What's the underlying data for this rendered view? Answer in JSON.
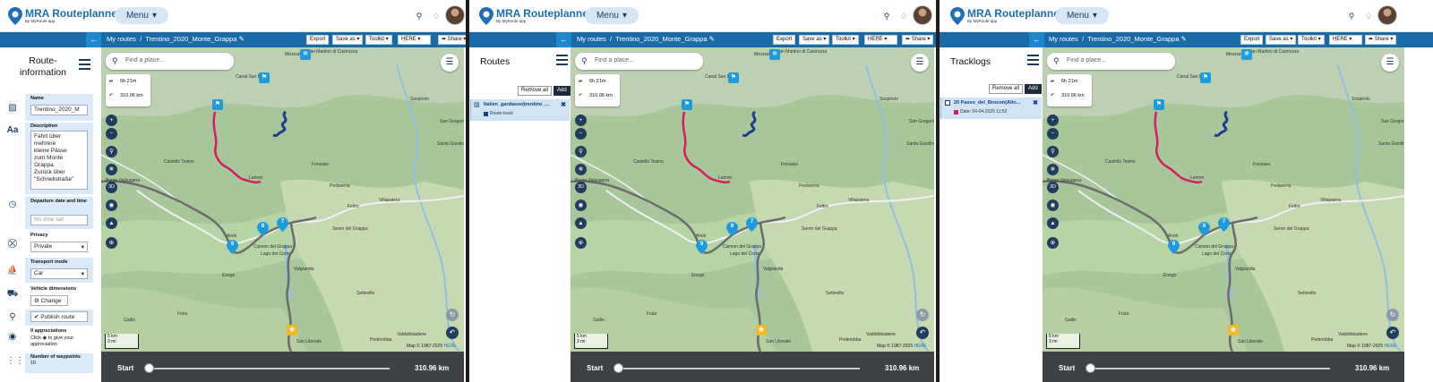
{
  "app": {
    "name": "MRA Routeplanner",
    "byline": "By MyRoute app",
    "menu_label": "Menu",
    "chevron": "▾"
  },
  "toolbar": {
    "my_routes": "My routes",
    "route_name": "Trentino_2020_Monte_Grappa",
    "export": "Export",
    "save_as": "Save as",
    "toolkit": "Toolkit",
    "map_provider": "HERE",
    "share": "Share"
  },
  "map": {
    "search_placeholder": "Find a place...",
    "duration": "6h 21m",
    "distance": "310.96 km",
    "scale_km": "5 km",
    "scale_mi": "3 mi",
    "copyright": "Map © 1987-2025 ",
    "copyright_link": "HERE",
    "places": [
      "Canal San Bovo",
      "Mezzano",
      "San Martino di Castrozza",
      "Castello Tesino",
      "Lamon",
      "Feltre",
      "Pedavena",
      "Villapaiera",
      "Fonzaso",
      "Santa Giustina",
      "Seren del Grappa",
      "Arsiè",
      "Cismon del Grappa",
      "Enego",
      "Lago del Corlo",
      "Valgranda",
      "Setteville",
      "Foza",
      "Gallio",
      "Valdobbiadene",
      "Pederobba",
      "San Liberale",
      "Borgo Valsugana",
      "San Gregorio nelle Alpi",
      "Sospirolo"
    ],
    "waypoint_labels": [
      "7",
      "8",
      "9"
    ]
  },
  "bottom": {
    "start_label": "Start",
    "distance": "310.96 km",
    "progress": 0
  },
  "panel1": {
    "title": "Route-information",
    "name_label": "Name",
    "name_value": "Trentino_2020_M",
    "desc_label": "Description",
    "desc_lines": [
      "Fahrt über",
      "mehrere",
      "kleine Pässe",
      "zum Monte",
      "Grappa.",
      "Zurück über",
      "\"Schnellstraße\""
    ],
    "departure_label": "Departure date and time",
    "departure_placeholder": "No time set",
    "privacy_label": "Privacy",
    "privacy_value": "Private",
    "transport_label": "Transport mode",
    "transport_value": "Car",
    "vehicle_label": "Vehicle dimensions",
    "change_button": "Change",
    "publish_button": "Publish route",
    "appreciations_title": "0 appreciations",
    "appreciations_text_1": "Click",
    "appreciations_text_2": "to give your appreciation",
    "waypoints_label": "Number of waypoints",
    "waypoints_value": "10"
  },
  "panel2": {
    "title": "Routes",
    "remove_all": "Remove all",
    "add": "Add",
    "route_title": "Italien_gardasee(trentino_...",
    "route_sub": "Route-track",
    "route_color": "#1b3f8b"
  },
  "panel3": {
    "title": "Tracklogs",
    "remove_all": "Remove all",
    "add": "Add",
    "track_title": "20 Passo_del_Brocon(Alto...",
    "track_date": "Date: 04-04-2025 11:52",
    "track_color": "#d81b60"
  },
  "colors": {
    "brand": "#1e6fb5",
    "toolbar": "#1b6aa8",
    "route_gray": "#6b6b6b",
    "route_red": "#d81b60",
    "route_blue": "#1b3f8b",
    "waypoint": "#1e9be0",
    "control": "#1f3d5c",
    "bottom_bar": "#3e4246"
  },
  "icons": [
    "logo-pin-icon",
    "search-icon",
    "bell-icon",
    "layers-icon",
    "hamburger-icon",
    "road-icon",
    "text-icon",
    "clock-icon",
    "lock-icon",
    "car-icon",
    "vehicle-icon",
    "pin-icon",
    "drop-icon",
    "waypoints-icon",
    "zoom-in-icon",
    "zoom-out-icon",
    "3d-icon",
    "refresh-icon",
    "undo-icon",
    "back-arrow-icon",
    "share-icon"
  ]
}
